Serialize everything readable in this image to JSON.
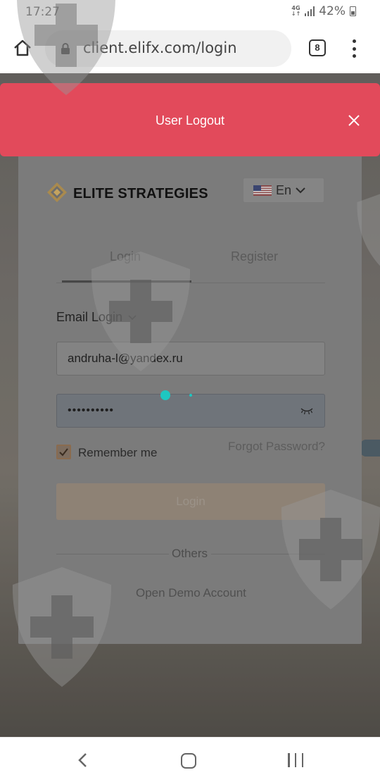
{
  "status_bar": {
    "time": "17:27",
    "network": "4G",
    "battery": "42%"
  },
  "browser": {
    "url": "client.elifx.com/login",
    "tab_count": "8"
  },
  "notification": {
    "message": "User Logout"
  },
  "login_card": {
    "brand": "ELITE STRATEGIES",
    "language": "En",
    "tabs": [
      {
        "label": "Login",
        "active": true
      },
      {
        "label": "Register",
        "active": false
      }
    ],
    "login_type": "Email Login",
    "email_value": "andruha-l@yandex.ru",
    "password_value": "••••••••••",
    "remember_label": "Remember me",
    "remember_checked": true,
    "forgot_label": "Forgot Password?",
    "login_button": "Login",
    "others_label": "Others",
    "demo_link": "Open Demo Account"
  },
  "colors": {
    "toast": "#e24a5b",
    "accent": "#8a6b4f",
    "loading_dot": "#1ec7c1"
  }
}
